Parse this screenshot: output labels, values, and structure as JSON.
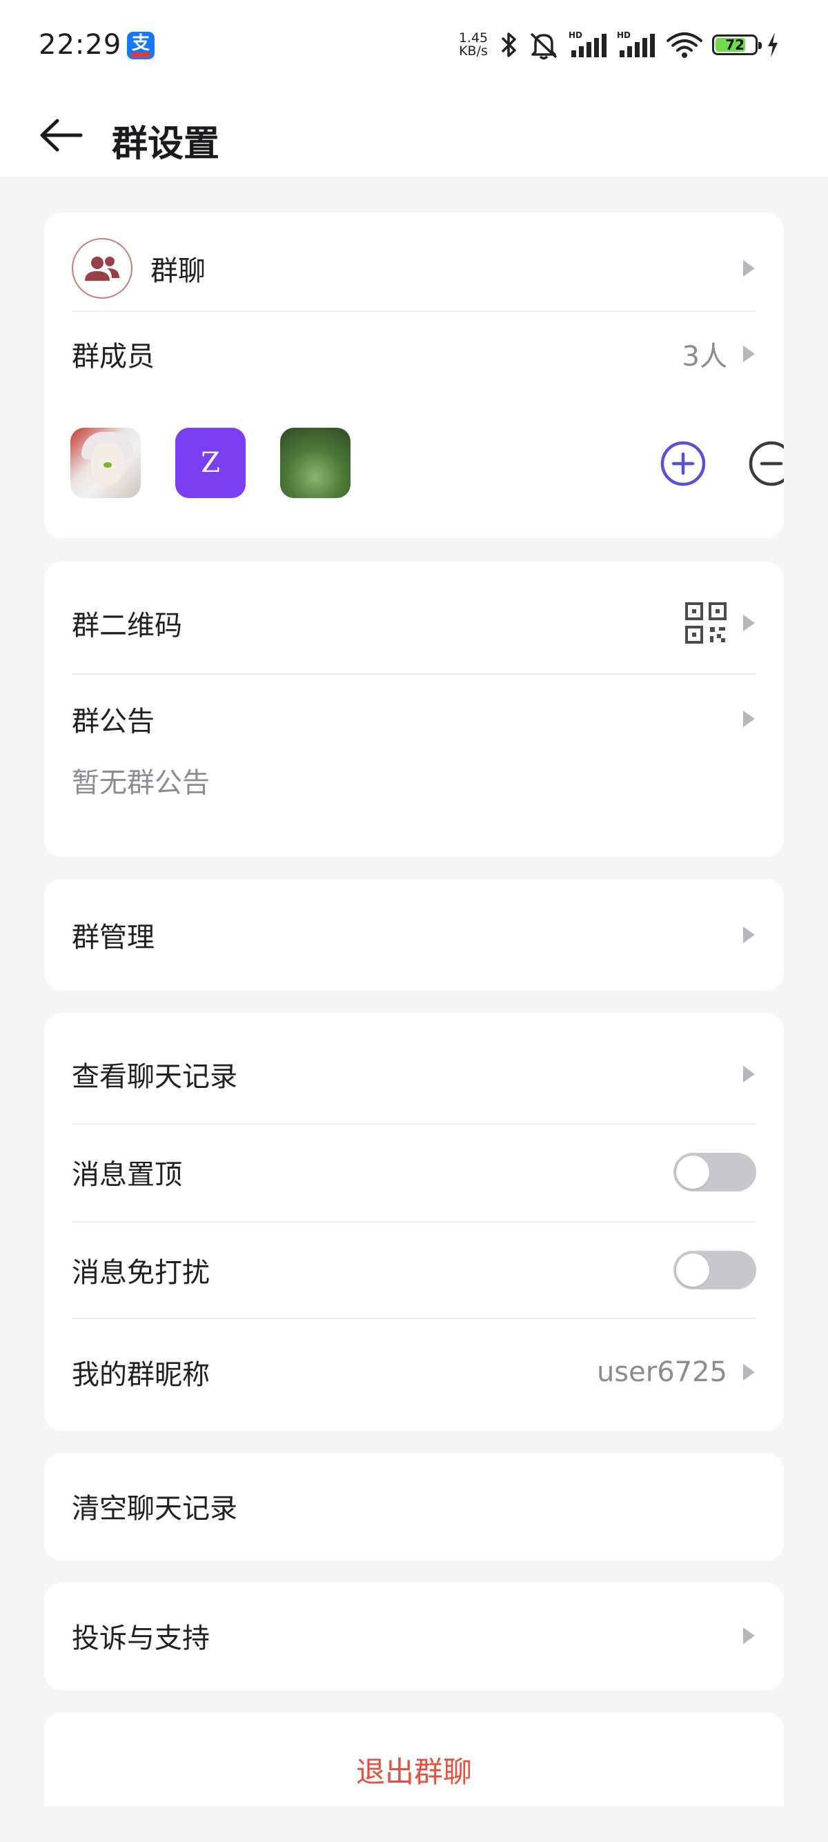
{
  "status_bar": {
    "time": "22:29",
    "app_icon_glyph": "支",
    "net_speed_value": "1.45",
    "net_speed_unit": "KB/s",
    "battery_level": "72",
    "icons": [
      "alipay-icon",
      "bluetooth-icon",
      "mute-icon",
      "signal-hd-icon",
      "signal-hd-icon",
      "wifi-icon",
      "battery-icon",
      "charging-icon"
    ]
  },
  "header": {
    "title": "群设置",
    "back_icon": "back-arrow-icon"
  },
  "group_card": {
    "group_name": "群聊",
    "members_label": "群成员",
    "members_count": "3人",
    "member_avatars": [
      "avatar-anime",
      "avatar-letter",
      "avatar-nature"
    ],
    "member_letter": "Z",
    "add_icon": "plus-circle-icon",
    "remove_icon": "minus-circle-icon",
    "accent_color": "#5b4fd6"
  },
  "info_card": {
    "qr_label": "群二维码",
    "qr_icon": "qr-code-icon",
    "notice_label": "群公告",
    "notice_placeholder": "暂无群公告"
  },
  "manage_card": {
    "manage_label": "群管理"
  },
  "chat_card": {
    "history_label": "查看聊天记录",
    "pin_label": "消息置顶",
    "pin_on": false,
    "dnd_label": "消息免打扰",
    "dnd_on": false,
    "nickname_label": "我的群昵称",
    "nickname_value": "user6725"
  },
  "clear_card": {
    "clear_label": "清空聊天记录"
  },
  "support_card": {
    "support_label": "投诉与支持"
  },
  "exit_card": {
    "exit_label": "退出群聊",
    "exit_color": "#e3503f"
  }
}
